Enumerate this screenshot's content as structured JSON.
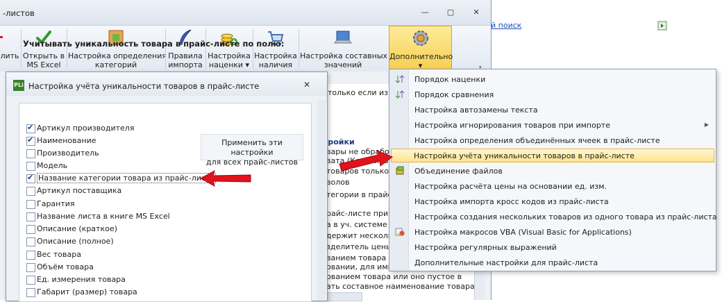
{
  "main_window": {
    "title": "-листов",
    "controls": {
      "minimize": "—",
      "maximize": "▢",
      "close": "✕"
    }
  },
  "ribbon": {
    "partial_left": "лить",
    "buttons": [
      {
        "id": "open_excel",
        "label_1": "Открыть в",
        "label_2": "MS Excel",
        "icon": "excel-check-icon"
      },
      {
        "id": "category_setup",
        "label_1": "Настройка определения",
        "label_2": "категорий",
        "icon": "category-table-icon"
      },
      {
        "id": "import_rules",
        "label_1": "Правила",
        "label_2": "импорта",
        "icon": "feather-pen-icon"
      },
      {
        "id": "markup_setup",
        "label_1": "Настройка",
        "label_2": "наценки ▾",
        "icon": "coins-icon"
      },
      {
        "id": "availability_setup",
        "label_1": "Настройка",
        "label_2": "наличия",
        "icon": "cart-icon"
      },
      {
        "id": "composite_values",
        "label_1": "Настройка составных",
        "label_2": "значений",
        "icon": "laptop-icon"
      },
      {
        "id": "extra",
        "label_1": "Дополнительно",
        "label_2": "▾",
        "icon": "gear-icon"
      }
    ],
    "scroll_glyph": "▾"
  },
  "background_text": {
    "top_line": "только если изме",
    "heading": "тройки",
    "lines": [
      "вары не обработа",
      "вата (Коравиль",
      "товаров только ин",
      "волов",
      "тегории в прайс-л",
      "",
      "райс-листе принад",
      "а в уч. системе",
      "держит нескольк",
      "зделитель ценых",
      "ванием товара сод",
      "овании, для импо",
      "ованием товара или оно пустое в",
      "ать составное наименование товара"
    ],
    "bottom_line": "ать составное наименование товара"
  },
  "right_page": {
    "link": "й поиск"
  },
  "dialog": {
    "title": "Настройка учёта уникальности товаров в прайс-листе",
    "app_icon_text": "PLi",
    "close": "✕",
    "heading": "Учитывать уникальность товара в прайс-листе по полю:",
    "checkboxes": [
      {
        "label": "Артикул производителя",
        "checked": true
      },
      {
        "label": "Наименование",
        "checked": true
      },
      {
        "label": "Производитель",
        "checked": false
      },
      {
        "label": "Модель",
        "checked": false
      },
      {
        "label": "Название категории товара из прайс-листа",
        "checked": true
      },
      {
        "label": "Артикул поставщика",
        "checked": false
      },
      {
        "label": "Гарантия",
        "checked": false
      },
      {
        "label": "Название листа в книге MS Excel",
        "checked": false
      },
      {
        "label": "Описание (краткое)",
        "checked": false
      },
      {
        "label": "Описание (полное)",
        "checked": false
      },
      {
        "label": "Вес товара",
        "checked": false
      },
      {
        "label": "Объём товара",
        "checked": false
      },
      {
        "label": "Ед. измерения товара",
        "checked": false
      },
      {
        "label": "Габарит (размер) товара",
        "checked": false
      }
    ],
    "apply_button_line1": "Применить эти настройки",
    "apply_button_line2": "для всех прайс-листов"
  },
  "menu": {
    "items": [
      {
        "label": "Порядок наценки",
        "icon": "sort-arrows-icon",
        "active": false,
        "submenu": false
      },
      {
        "label": "Порядок сравнения",
        "icon": "sort-arrows-icon",
        "active": false,
        "submenu": false
      },
      {
        "label": "Настройка автозамены текста",
        "icon": "",
        "active": false,
        "submenu": false
      },
      {
        "label": "Настройка игнорирования товаров при импорте",
        "icon": "",
        "active": false,
        "submenu": true
      },
      {
        "label": "Настройка определения объединённых ячеек в прайс-листе",
        "icon": "",
        "active": false,
        "submenu": false
      },
      {
        "label": "Настройка учёта уникальности товаров в прайс-листе",
        "icon": "",
        "active": true,
        "submenu": false
      },
      {
        "label": "Объединение файлов",
        "icon": "merge-files-icon",
        "active": false,
        "submenu": false
      },
      {
        "label": "Настройка расчёта цены на основании ед. изм.",
        "icon": "",
        "active": false,
        "submenu": false
      },
      {
        "label": "Настройка импорта кросс кодов из прайс-листа",
        "icon": "",
        "active": false,
        "submenu": false
      },
      {
        "label": "Настройка создания нескольких товаров из одного товара из прайс-листа",
        "icon": "",
        "active": false,
        "submenu": false
      },
      {
        "label": "Настройка макросов VBA (Visual Basic for Applications)",
        "icon": "vba-macro-icon",
        "active": false,
        "submenu": false
      },
      {
        "label": "Настройка регулярных выражений",
        "icon": "",
        "active": false,
        "submenu": false
      },
      {
        "label": "Дополнительные настройки для прайс-листа",
        "icon": "",
        "active": false,
        "submenu": false
      }
    ],
    "submenu_glyph": "▶"
  },
  "colors": {
    "highlight": "#fde48c",
    "arrow": "#e0141a",
    "link": "#1d4fb5"
  }
}
